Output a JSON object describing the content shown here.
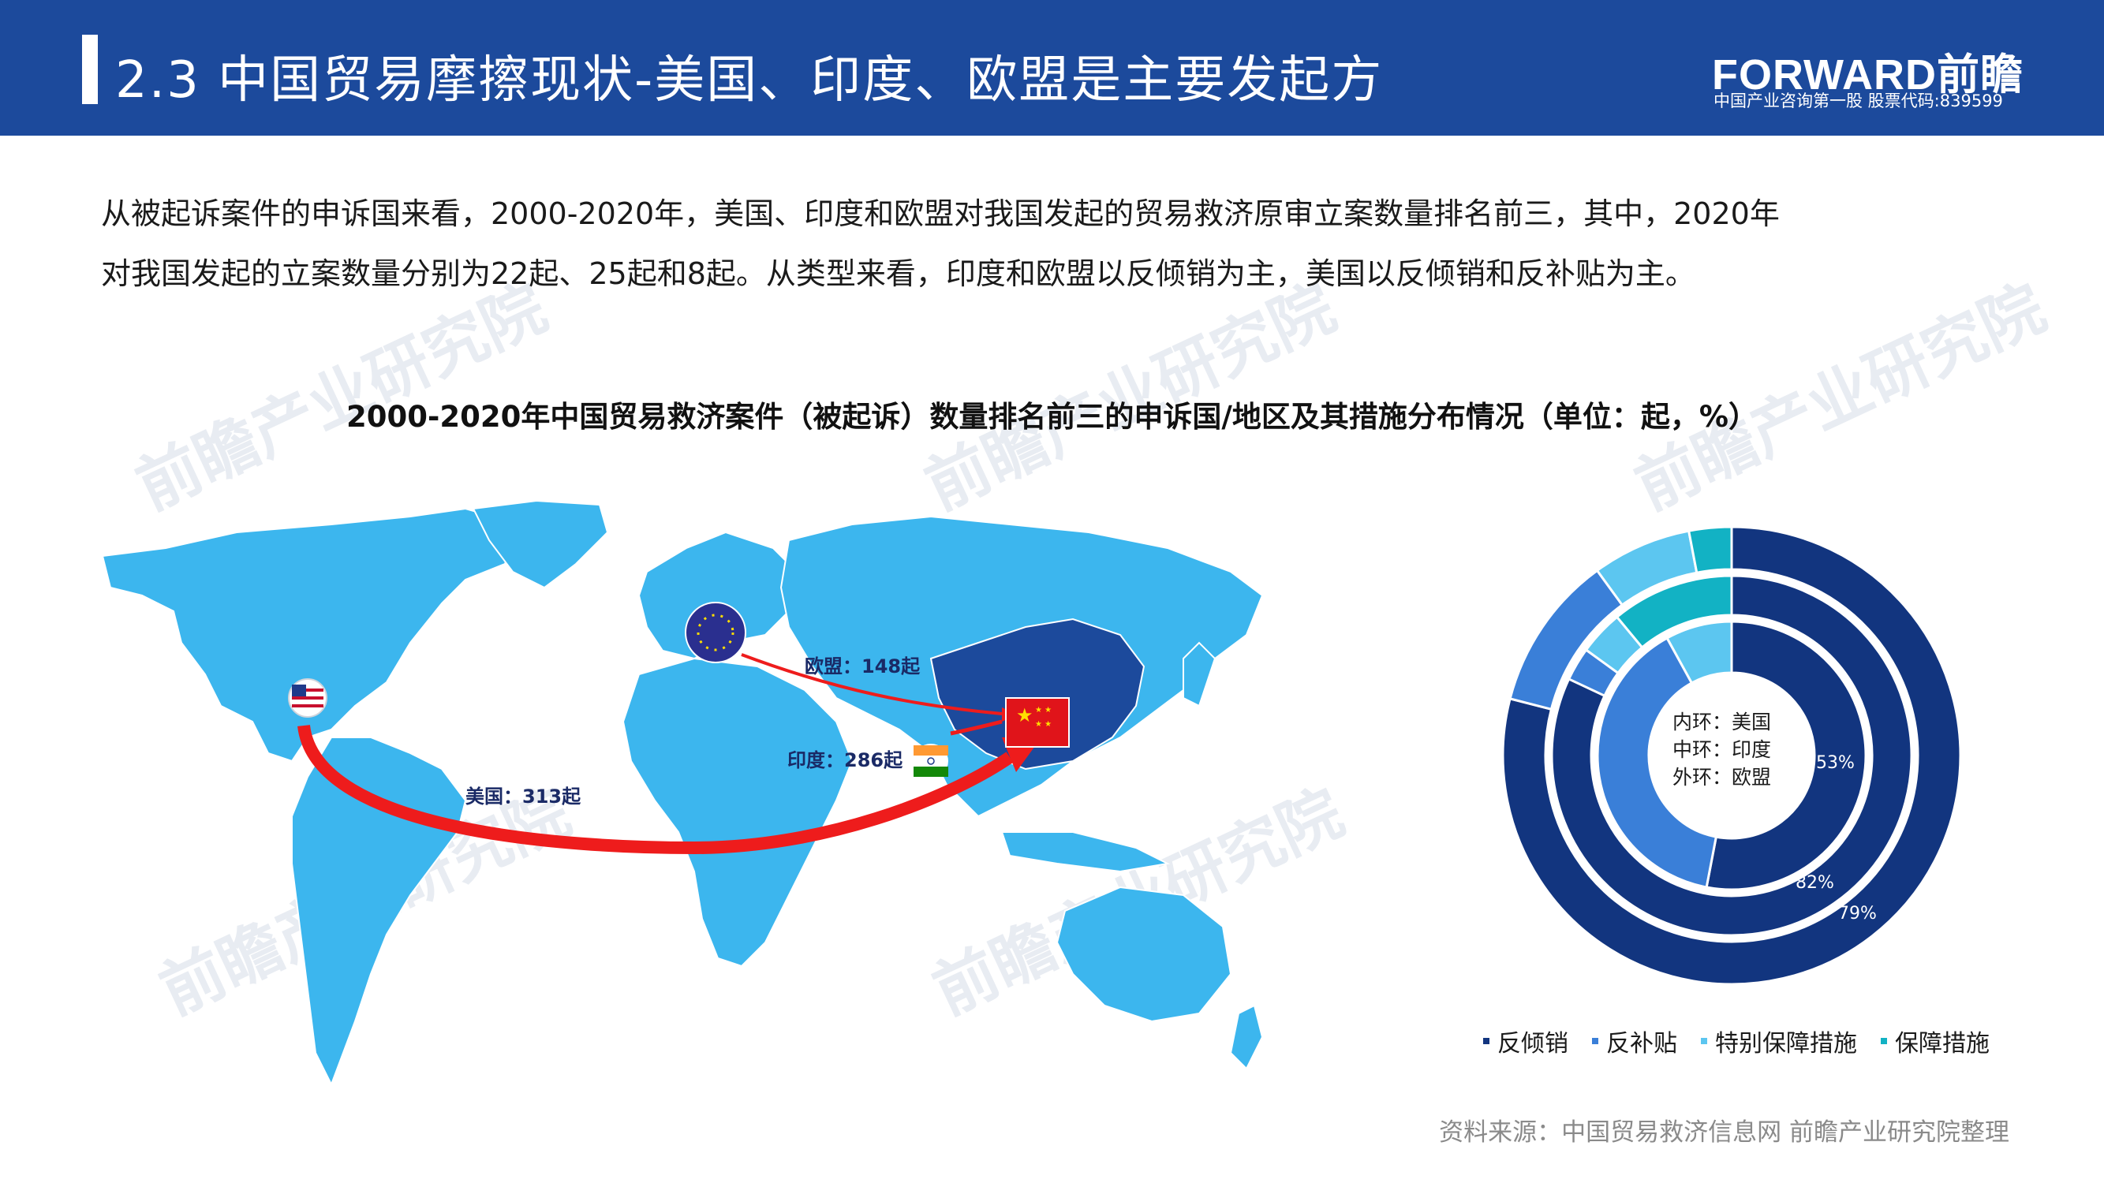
{
  "header": {
    "title": "2.3 中国贸易摩擦现状-美国、印度、欧盟是主要发起方",
    "brand": "FORWARD前瞻",
    "brand_sub": "中国产业咨询第一股 股票代码:839599"
  },
  "paragraph": {
    "line1": "从被起诉案件的申诉国来看，2000-2020年，美国、印度和欧盟对我国发起的贸易救济原审立案数量排名前三，其中，2020年",
    "line2": "对我国发起的立案数量分别为22起、25起和8起。从类型来看，印度和欧盟以反倾销为主，美国以反倾销和反补贴为主。"
  },
  "watermark": "前瞻产业研究院",
  "map": {
    "labels": {
      "eu": "欧盟：148起",
      "india": "印度：286起",
      "usa": "美国：313起"
    },
    "colors": {
      "land": "#3cb6ee",
      "china": "#1c4a9c",
      "arrow": "#ee1c1c"
    }
  },
  "chart_data": {
    "type": "pie",
    "title": "2000-2020年中国贸易救济案件（被起诉）数量排名前三的申诉国/地区及其措施分布情况（单位：起，%）",
    "categories": [
      "反倾销",
      "反补贴",
      "特别保障措施",
      "保障措施"
    ],
    "colors": [
      "#12357f",
      "#3a7fd8",
      "#5cc6f0",
      "#12b2c4"
    ],
    "center_labels": [
      "内环：美国",
      "中环：印度",
      "外环：欧盟"
    ],
    "series": [
      {
        "name": "美国",
        "values": [
          53,
          39,
          8,
          0
        ],
        "label": "53%"
      },
      {
        "name": "印度",
        "values": [
          82,
          3,
          4,
          11
        ],
        "label": "82%"
      },
      {
        "name": "欧盟",
        "values": [
          79,
          11,
          7,
          3
        ],
        "label": "79%"
      }
    ]
  },
  "source": "资料来源：中国贸易救济信息网 前瞻产业研究院整理"
}
